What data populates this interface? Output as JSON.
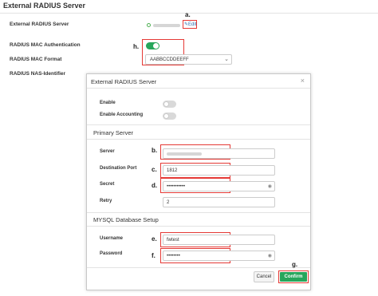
{
  "page": {
    "title": "External RADIUS Server"
  },
  "form": {
    "server_label": "External RADIUS Server",
    "edit_label": "Edit",
    "mac_auth_label": "RADIUS MAC Authentication",
    "mac_auth_enabled": true,
    "mac_format_label": "RADIUS MAC Format",
    "mac_format_value": "AABBCCDDEEFF",
    "nas_identifier_label": "RADIUS NAS-Identifier"
  },
  "modal": {
    "title": "External RADIUS Server",
    "close_symbol": "×",
    "enable_label": "Enable",
    "enable_on": false,
    "accounting_label": "Enable Accounting",
    "accounting_on": false,
    "primary_section": "Primary Server",
    "server_label": "Server",
    "port_label": "Destination Port",
    "port_value": "1812",
    "secret_label": "Secret",
    "secret_value": "•••••••••••",
    "retry_label": "Retry",
    "retry_value": "2",
    "mysql_section": "MYSQL Database Setup",
    "username_label": "Username",
    "username_value": "fwtest",
    "password_label": "Password",
    "password_value": "••••••••",
    "cancel_label": "Cancel",
    "confirm_label": "Confirm"
  },
  "annotations": {
    "a": "a.",
    "b": "b.",
    "c": "c.",
    "d": "d.",
    "e": "e.",
    "f": "f.",
    "g": "g.",
    "h": "h."
  },
  "colors": {
    "accent_green": "#26a65b",
    "highlight_red": "#e53935",
    "link_blue": "#2a6db0"
  },
  "icons": {
    "edit": "pencil-icon",
    "status": "status-circle-icon",
    "reveal": "eye-icon"
  }
}
